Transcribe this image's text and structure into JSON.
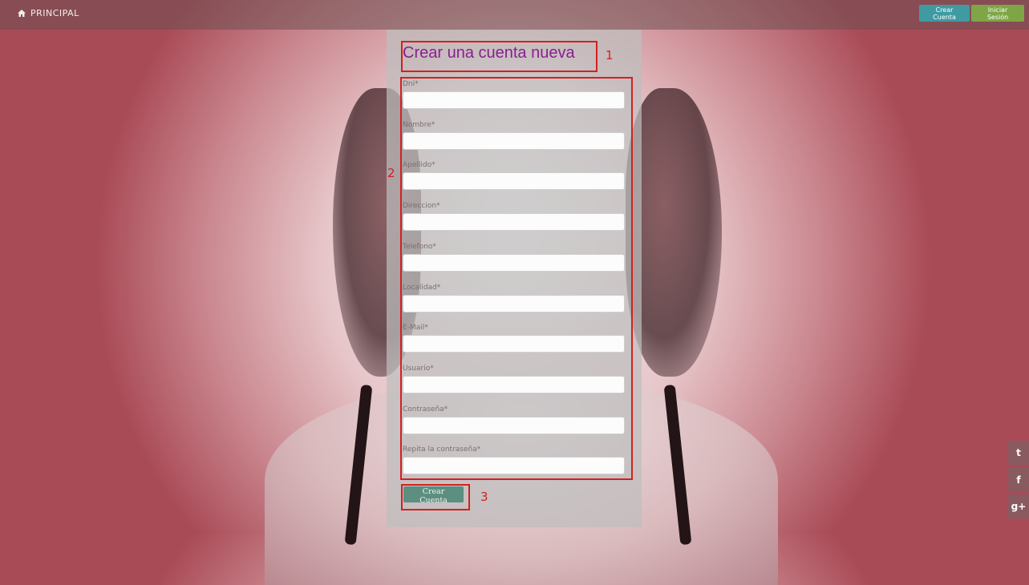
{
  "nav": {
    "brand_label": "PRINCIPAL",
    "create_account_label": "Crear Cuenta",
    "login_label": "Iniciar Sesión"
  },
  "form": {
    "title": "Crear una cuenta nueva",
    "fields": [
      {
        "label": "Dni*",
        "value": ""
      },
      {
        "label": "Nombre*",
        "value": ""
      },
      {
        "label": "Apellido*",
        "value": ""
      },
      {
        "label": "Direccion*",
        "value": ""
      },
      {
        "label": "Telefono*",
        "value": ""
      },
      {
        "label": "Localidad*",
        "value": ""
      },
      {
        "label": "E-Mail*",
        "value": ""
      },
      {
        "label": "Usuario*",
        "value": ""
      },
      {
        "label": "Contraseña*",
        "value": ""
      },
      {
        "label": "Repita la contraseña*",
        "value": ""
      }
    ],
    "submit_label": "Crear Cuenta"
  },
  "annotations": [
    "1",
    "2",
    "3"
  ],
  "social": {
    "icons": [
      "twitter-icon",
      "facebook-icon",
      "google-plus-icon"
    ],
    "twitter_glyph": "t",
    "facebook_glyph": "f",
    "gplus_glyph": "g+"
  },
  "colors": {
    "title": "#8a1f90",
    "annotation": "#d42020",
    "create_button": "#3f9aa2",
    "login_button": "#7ea646",
    "submit_button": "#5c8f7f"
  }
}
